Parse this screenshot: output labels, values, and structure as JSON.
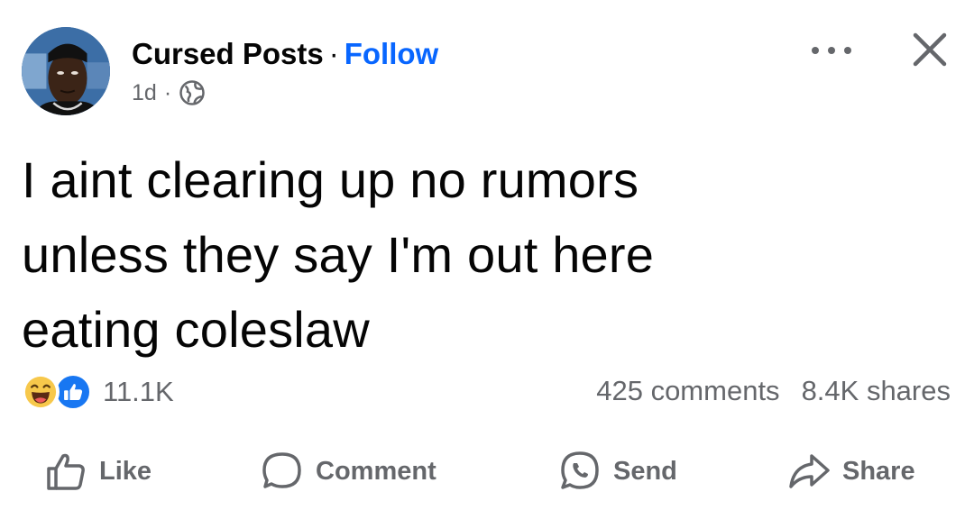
{
  "post": {
    "page_name": "Cursed Posts",
    "separator": "·",
    "follow_label": "Follow",
    "timestamp": "1d",
    "meta_separator": "·",
    "privacy_icon": "globe-icon",
    "text_lines": [
      "I aint clearing up no rumors",
      "unless they say I'm out here",
      "eating coleslaw"
    ]
  },
  "engagement": {
    "reaction_icons": [
      "haha-emoji-icon",
      "like-reaction-icon"
    ],
    "reaction_count": "11.1K",
    "comments": "425 comments",
    "shares": "8.4K shares"
  },
  "actions": {
    "like_label": "Like",
    "comment_label": "Comment",
    "send_label": "Send",
    "share_label": "Share"
  },
  "colors": {
    "follow": "#0866ff",
    "secondary_text": "#65676b",
    "like_blue": "#1877f2",
    "haha_yellow": "#f7c84b"
  }
}
